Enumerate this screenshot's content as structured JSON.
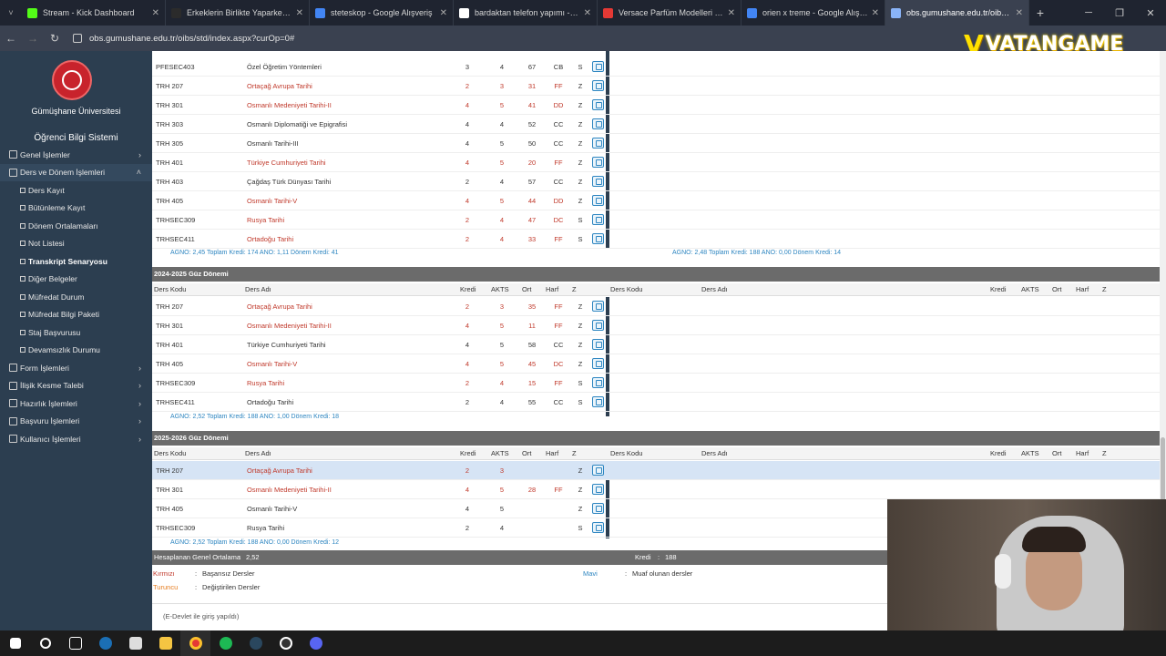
{
  "browser": {
    "tabs": [
      {
        "title": "Stream - Kick Dashboard",
        "icon": "kick-icon",
        "color": "#53fc18"
      },
      {
        "title": "Erkeklerin Birlikte Yaparken En",
        "icon": "video-icon",
        "color": "#2b2b2b"
      },
      {
        "title": "steteskop - Google Alışveriş",
        "icon": "shopping-icon",
        "color": "#4285f4"
      },
      {
        "title": "bardaktan telefon yapımı - Goo",
        "icon": "google-icon",
        "color": "#ffffff"
      },
      {
        "title": "Versace Parfüm Modelleri ve Fi",
        "icon": "b-icon",
        "color": "#e53935"
      },
      {
        "title": "orien x treme - Google Alışveriş",
        "icon": "shopping-icon",
        "color": "#4285f4"
      },
      {
        "title": "obs.gumushane.edu.tr/oibs/std",
        "icon": "globe-icon",
        "color": "#8ab4f8"
      }
    ],
    "new_tab": "+",
    "url": "obs.gumushane.edu.tr/oibs/std/index.aspx?curOp=0#"
  },
  "overlay": {
    "logo_v": "V",
    "logo_text": "VATANGAME"
  },
  "sidebar": {
    "university": "Gümüşhane Üniversitesi",
    "system": "Öğrenci Bilgi Sistemi",
    "menu": [
      {
        "label": "Genel İşlemler",
        "chev": "›"
      },
      {
        "label": "Ders ve Dönem İşlemleri",
        "chev": "˄"
      }
    ],
    "submenu": [
      "Ders Kayıt",
      "Bütünleme Kayıt",
      "Dönem Ortalamaları",
      "Not Listesi",
      "Transkript Senaryosu",
      "Diğer Belgeler",
      "Müfredat Durum",
      "Müfredat Bilgi Paketi",
      "Staj Başvurusu",
      "Devamsızlık Durumu"
    ],
    "menu2": [
      {
        "label": "Form İşlemleri",
        "chev": "›"
      },
      {
        "label": "İlişik Kesme Talebi",
        "chev": "›"
      },
      {
        "label": "Hazırlık İşlemleri",
        "chev": "›"
      },
      {
        "label": "Başvuru İşlemleri",
        "chev": "›"
      },
      {
        "label": "Kullanıcı İşlemleri",
        "chev": "›"
      }
    ]
  },
  "block1": {
    "rows": [
      {
        "code": "PFESEC403",
        "name": "Özel Öğretim Yöntemleri",
        "kredi": "3",
        "akts": "4",
        "ort": "67",
        "harf": "CB",
        "z": "S",
        "red": false
      },
      {
        "code": "TRH 207",
        "name": "Ortaçağ Avrupa Tarihi",
        "kredi": "2",
        "akts": "3",
        "ort": "31",
        "harf": "FF",
        "z": "Z",
        "red": true
      },
      {
        "code": "TRH 301",
        "name": "Osmanlı Medeniyeti Tarihi-II",
        "kredi": "4",
        "akts": "5",
        "ort": "41",
        "harf": "DD",
        "z": "Z",
        "red": true
      },
      {
        "code": "TRH 303",
        "name": "Osmanlı Diplomatiği ve Epigrafisi",
        "kredi": "4",
        "akts": "4",
        "ort": "52",
        "harf": "CC",
        "z": "Z",
        "red": false
      },
      {
        "code": "TRH 305",
        "name": "Osmanlı Tarihi-III",
        "kredi": "4",
        "akts": "5",
        "ort": "50",
        "harf": "CC",
        "z": "Z",
        "red": false
      },
      {
        "code": "TRH 401",
        "name": "Türkiye Cumhuriyeti Tarihi",
        "kredi": "4",
        "akts": "5",
        "ort": "20",
        "harf": "FF",
        "z": "Z",
        "red": true
      },
      {
        "code": "TRH 403",
        "name": "Çağdaş Türk Dünyası Tarihi",
        "kredi": "2",
        "akts": "4",
        "ort": "57",
        "harf": "CC",
        "z": "Z",
        "red": false
      },
      {
        "code": "TRH 405",
        "name": "Osmanlı Tarihi-V",
        "kredi": "4",
        "akts": "5",
        "ort": "44",
        "harf": "DD",
        "z": "Z",
        "red": true
      },
      {
        "code": "TRHSEC309",
        "name": "Rusya Tarihi",
        "kredi": "2",
        "akts": "4",
        "ort": "47",
        "harf": "DC",
        "z": "S",
        "red": true
      },
      {
        "code": "TRHSEC411",
        "name": "Ortadoğu Tarihi",
        "kredi": "2",
        "akts": "4",
        "ort": "33",
        "harf": "FF",
        "z": "S",
        "red": true
      }
    ],
    "summary_left": "AGNO: 2,45   Toplam Kredi: 174   ANO: 1,11   Dönem Kredi: 41",
    "summary_right": "AGNO: 2,48   Toplam Kredi: 188   ANO: 0,00   Dönem Kredi: 14"
  },
  "headers": {
    "code": "Ders Kodu",
    "name": "Ders Adı",
    "kredi": "Kredi",
    "akts": "AKTS",
    "ort": "Ort",
    "harf": "Harf",
    "z": "Z"
  },
  "block2": {
    "title": "2024-2025 Güz Dönemi",
    "rows": [
      {
        "code": "TRH 207",
        "name": "Ortaçağ Avrupa Tarihi",
        "kredi": "2",
        "akts": "3",
        "ort": "35",
        "harf": "FF",
        "z": "Z",
        "red": true
      },
      {
        "code": "TRH 301",
        "name": "Osmanlı Medeniyeti Tarihi-II",
        "kredi": "4",
        "akts": "5",
        "ort": "11",
        "harf": "FF",
        "z": "Z",
        "red": true
      },
      {
        "code": "TRH 401",
        "name": "Türkiye Cumhuriyeti Tarihi",
        "kredi": "4",
        "akts": "5",
        "ort": "58",
        "harf": "CC",
        "z": "Z",
        "red": false
      },
      {
        "code": "TRH 405",
        "name": "Osmanlı Tarihi-V",
        "kredi": "4",
        "akts": "5",
        "ort": "45",
        "harf": "DC",
        "z": "Z",
        "red": true
      },
      {
        "code": "TRHSEC309",
        "name": "Rusya Tarihi",
        "kredi": "2",
        "akts": "4",
        "ort": "15",
        "harf": "FF",
        "z": "S",
        "red": true
      },
      {
        "code": "TRHSEC411",
        "name": "Ortadoğu Tarihi",
        "kredi": "2",
        "akts": "4",
        "ort": "55",
        "harf": "CC",
        "z": "S",
        "red": false
      }
    ],
    "summary": "AGNO: 2,52   Toplam Kredi: 188   ANO: 1,00   Dönem Kredi: 18"
  },
  "block3": {
    "title": "2025-2026 Güz Dönemi",
    "rows": [
      {
        "code": "TRH 207",
        "name": "Ortaçağ Avrupa Tarihi",
        "kredi": "2",
        "akts": "3",
        "ort": "",
        "harf": "",
        "z": "Z",
        "red": true,
        "hl": true
      },
      {
        "code": "TRH 301",
        "name": "Osmanlı Medeniyeti Tarihi-II",
        "kredi": "4",
        "akts": "5",
        "ort": "28",
        "harf": "FF",
        "z": "Z",
        "red": true
      },
      {
        "code": "TRH 405",
        "name": "Osmanlı Tarihi-V",
        "kredi": "4",
        "akts": "5",
        "ort": "",
        "harf": "",
        "z": "Z",
        "red": false
      },
      {
        "code": "TRHSEC309",
        "name": "Rusya Tarihi",
        "kredi": "2",
        "akts": "4",
        "ort": "",
        "harf": "",
        "z": "S",
        "red": false
      }
    ],
    "summary": "AGNO: 2,52   Toplam Kredi: 188   ANO: 0,00   Dönem Kredi: 12"
  },
  "gpa": {
    "label": "Hesaplanan Genel Ortalama",
    "sep": ":",
    "value": "2,52",
    "kredi_label": "Kredi",
    "kredi_value": "188"
  },
  "legend": {
    "red_label": "Kırmızı",
    "red_text": "Başarısız Dersler",
    "orange_label": "Turuncu",
    "orange_text": "Değiştirilen Dersler",
    "blue_label": "Mavi",
    "blue_text": "Muaf olunan dersler",
    "sep": ":"
  },
  "footer_note": "(E-Devlet ile giriş yapıldı)",
  "colors": {
    "fail": "#c0392b",
    "orange": "#e67e22",
    "blue": "#2e86c1",
    "sidebar": "#2c3e50"
  }
}
